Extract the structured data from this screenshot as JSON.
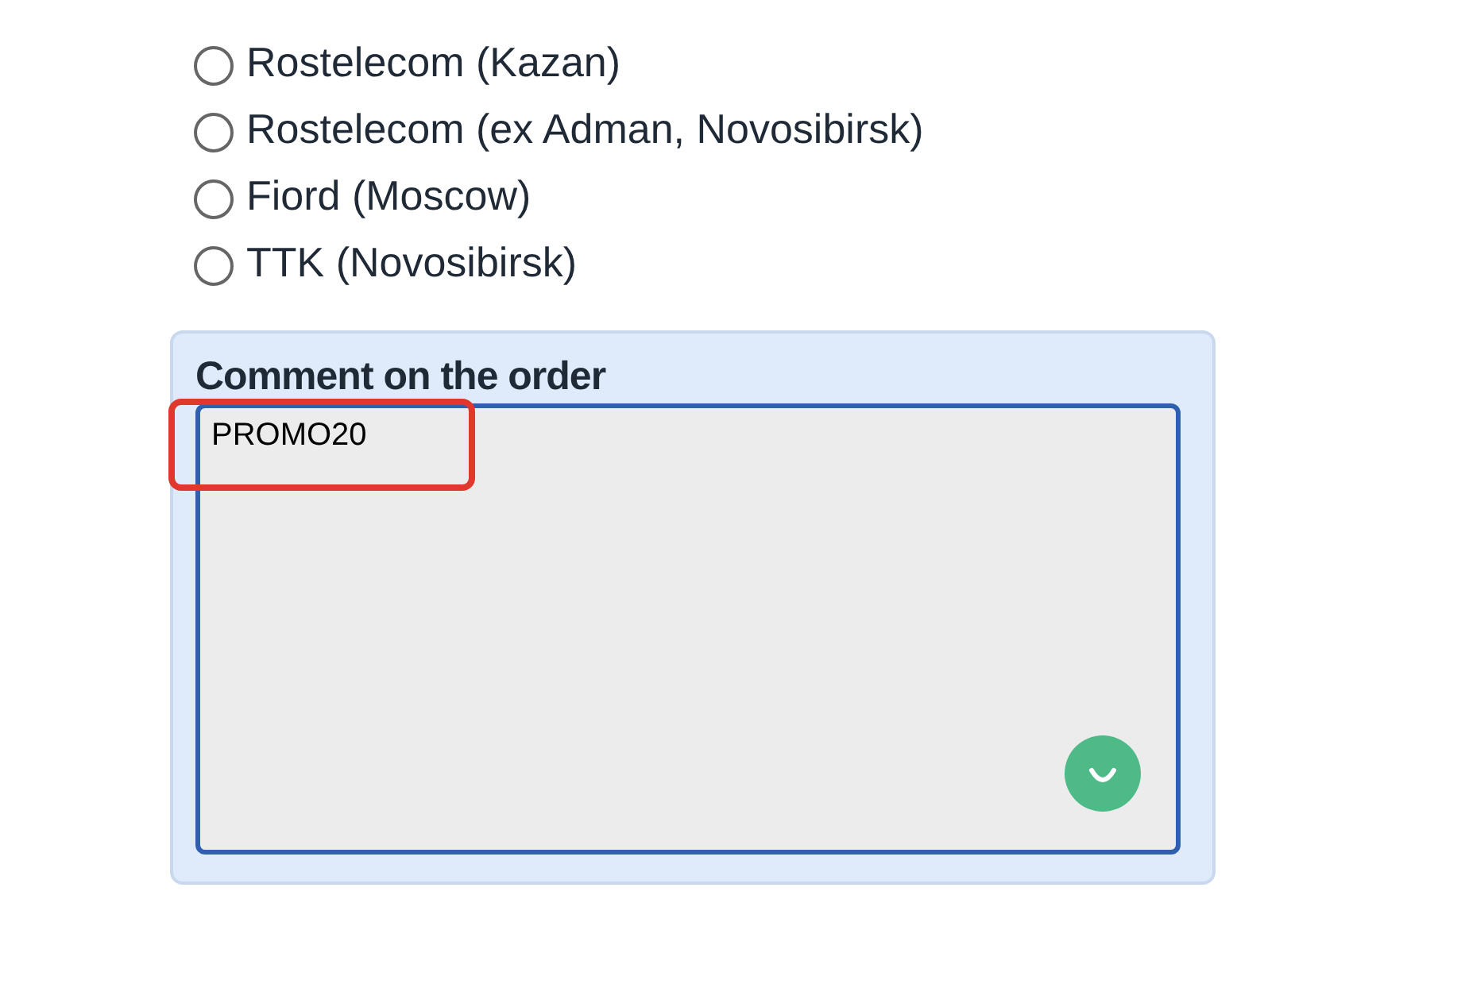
{
  "radio_options": [
    {
      "label": "Rostelecom (Kazan)",
      "selected": false
    },
    {
      "label": "Rostelecom (ex Adman, Novosibirsk)",
      "selected": false
    },
    {
      "label": "Fiord (Moscow)",
      "selected": false
    },
    {
      "label": "TTK (Novosibirsk)",
      "selected": false
    }
  ],
  "comment": {
    "label": "Comment on the order",
    "value": "PROMO20"
  }
}
